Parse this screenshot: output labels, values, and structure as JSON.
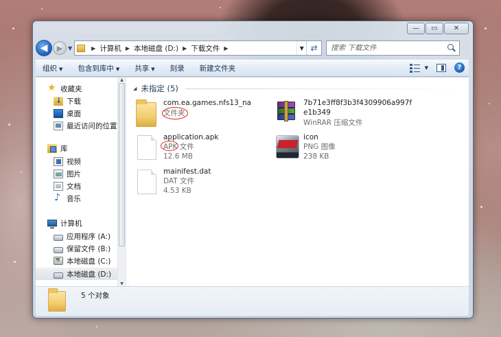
{
  "window": {
    "caption_buttons": {
      "minimize": "—",
      "maximize": "▭",
      "close": "✕"
    }
  },
  "address_bar": {
    "breadcrumbs": [
      "计算机",
      "本地磁盘 (D:)",
      "下载文件"
    ]
  },
  "search": {
    "placeholder": "搜索 下载文件"
  },
  "toolbar": {
    "organize": "组织",
    "include_in_library": "包含到库中",
    "share": "共享",
    "burn": "刻录",
    "new_folder": "新建文件夹"
  },
  "sidebar": {
    "favorites": {
      "label": "收藏夹",
      "items": [
        {
          "label": "下载",
          "icon": "downloads-folder-icon"
        },
        {
          "label": "桌面",
          "icon": "desktop-icon"
        },
        {
          "label": "最近访问的位置",
          "icon": "recent-places-icon"
        }
      ]
    },
    "libraries": {
      "label": "库",
      "items": [
        {
          "label": "视频",
          "icon": "videos-icon"
        },
        {
          "label": "图片",
          "icon": "pictures-icon"
        },
        {
          "label": "文档",
          "icon": "documents-icon"
        },
        {
          "label": "音乐",
          "icon": "music-icon"
        }
      ]
    },
    "computer": {
      "label": "计算机",
      "items": [
        {
          "label": "应用程序 (A:)",
          "icon": "drive-icon"
        },
        {
          "label": "保留文件 (B:)",
          "icon": "drive-icon"
        },
        {
          "label": "本地磁盘 (C:)",
          "icon": "windows-drive-icon"
        },
        {
          "label": "本地磁盘 (D:)",
          "icon": "drive-icon",
          "selected": true
        }
      ]
    }
  },
  "main": {
    "group_label": "未指定 (5)",
    "files": [
      {
        "name": "com.ea.games.nfs13_na",
        "type": "文件夹",
        "size": "",
        "icon": "folder-icon"
      },
      {
        "name": "7b71e3ff8f3b3f4309906a997fe1b349",
        "type": "WinRAR 压缩文件",
        "size": "",
        "icon": "winrar-archive-icon"
      },
      {
        "name": "application.apk",
        "type": "APK 文件",
        "size": "12.6 MB",
        "icon": "file-icon"
      },
      {
        "name": "icon",
        "type": "PNG 图像",
        "size": "238 KB",
        "icon": "game-image-icon"
      },
      {
        "name": "mainifest.dat",
        "type": "DAT 文件",
        "size": "4.53 KB",
        "icon": "file-icon"
      }
    ]
  },
  "details_pane": {
    "count": "5 个对象"
  },
  "colors": {
    "annotation": "#e2231a",
    "accent": "#1b5fb7"
  }
}
